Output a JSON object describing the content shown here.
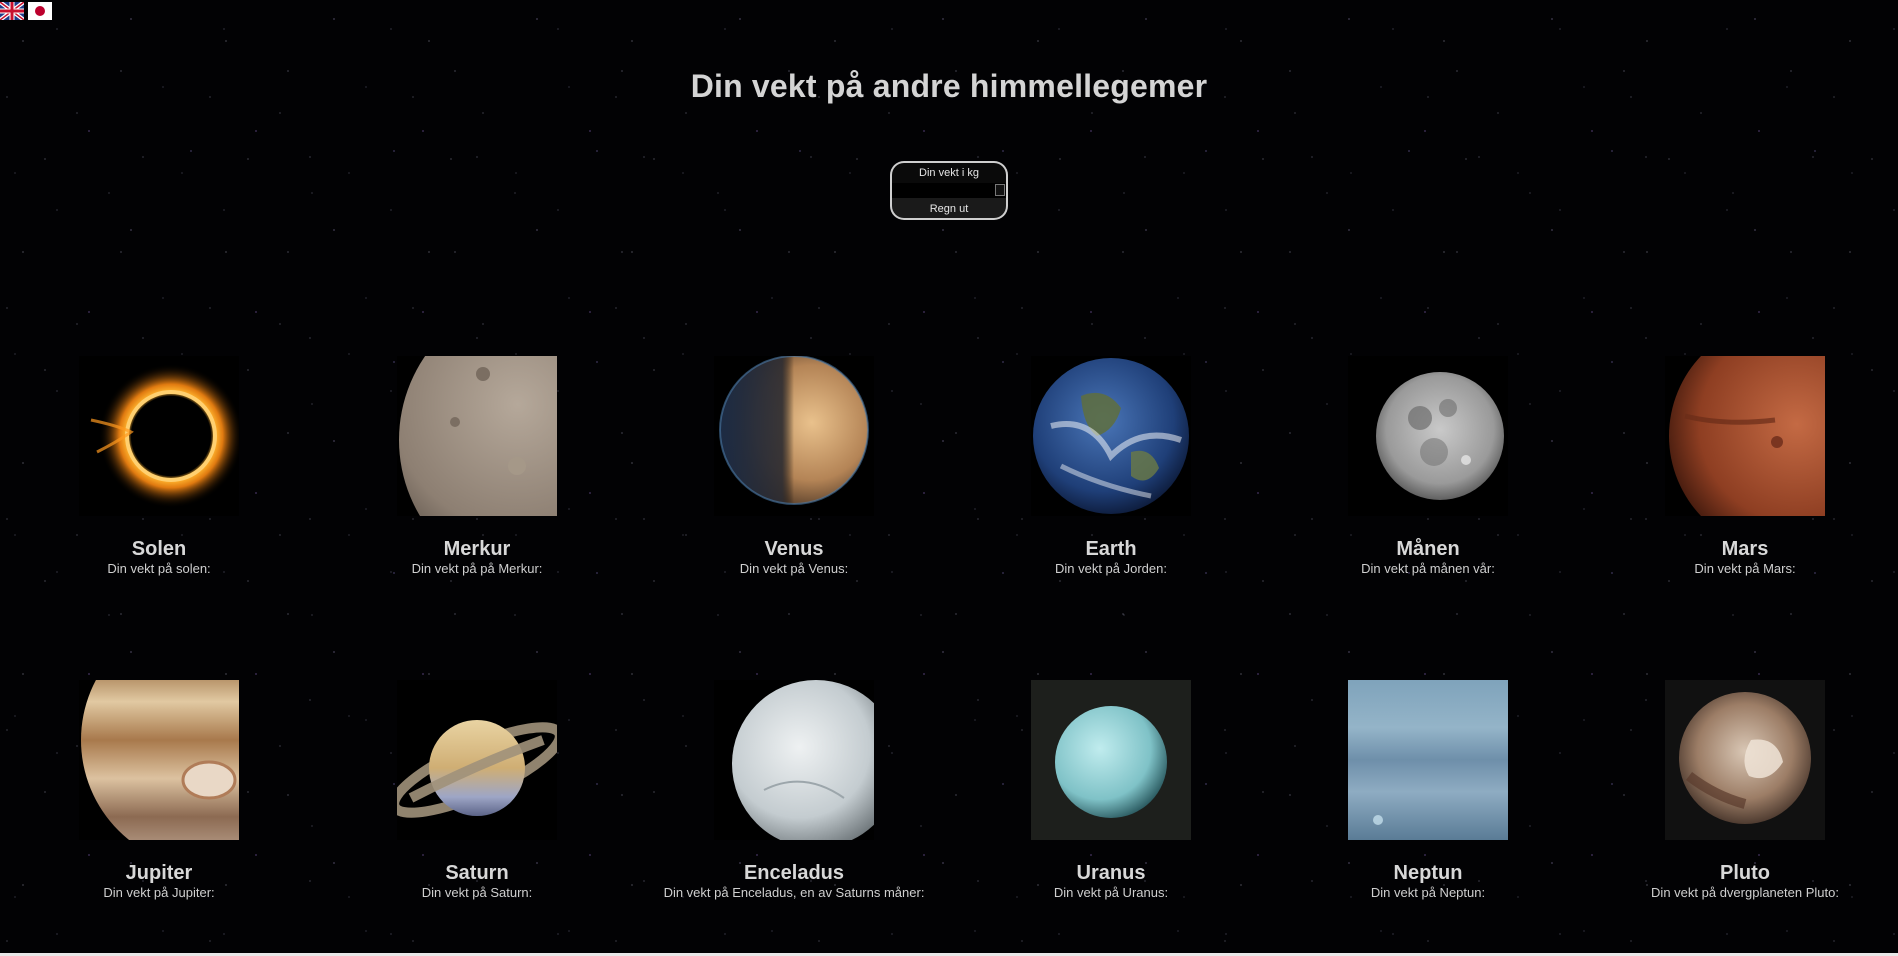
{
  "language_flags": [
    {
      "name": "uk-flag-icon",
      "country": "UK"
    },
    {
      "name": "japan-flag-icon",
      "country": "Japan"
    }
  ],
  "title": "Din vekt på andre himmellegemer",
  "calculator": {
    "label": "Din vekt i kg",
    "input_value": "",
    "button_label": "Regn ut"
  },
  "bodies": [
    {
      "name": "Solen",
      "caption": "Din vekt på solen:",
      "icon": "sun-icon"
    },
    {
      "name": "Merkur",
      "caption": "Din vekt på på Merkur:",
      "icon": "mercury-icon"
    },
    {
      "name": "Venus",
      "caption": "Din vekt på Venus:",
      "icon": "venus-icon"
    },
    {
      "name": "Earth",
      "caption": "Din vekt på Jorden:",
      "icon": "earth-icon"
    },
    {
      "name": "Månen",
      "caption": "Din vekt på månen vår:",
      "icon": "moon-icon"
    },
    {
      "name": "Mars",
      "caption": "Din vekt på Mars:",
      "icon": "mars-icon"
    },
    {
      "name": "Jupiter",
      "caption": "Din vekt på Jupiter:",
      "icon": "jupiter-icon"
    },
    {
      "name": "Saturn",
      "caption": "Din vekt på Saturn:",
      "icon": "saturn-icon"
    },
    {
      "name": "Enceladus",
      "caption": "Din vekt på Enceladus, en av Saturns måner:",
      "icon": "enceladus-icon"
    },
    {
      "name": "Uranus",
      "caption": "Din vekt på Uranus:",
      "icon": "uranus-icon"
    },
    {
      "name": "Neptun",
      "caption": "Din vekt på Neptun:",
      "icon": "neptune-icon"
    },
    {
      "name": "Pluto",
      "caption": "Din vekt på dvergplaneten Pluto:",
      "icon": "pluto-icon"
    }
  ]
}
